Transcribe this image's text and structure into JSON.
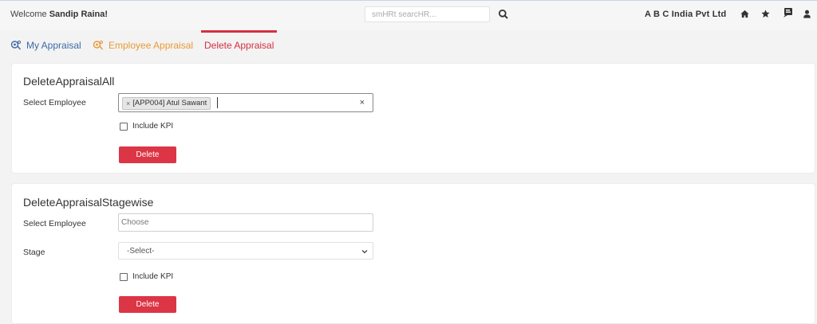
{
  "header": {
    "welcome_prefix": "Welcome",
    "user_name": "Sandip Raina!",
    "search_placeholder": "smHRt searcHR...",
    "company": "A B C India Pvt Ltd",
    "icons": [
      "search-icon",
      "home-icon",
      "star-icon",
      "notification-icon",
      "user-icon"
    ]
  },
  "tabs": [
    {
      "label": "My Appraisal",
      "icon": "appraisal-icon",
      "color": "#3d6aa8"
    },
    {
      "label": "Employee Appraisal",
      "icon": "appraisal-icon",
      "color": "#e89a34"
    },
    {
      "label": "Delete Appraisal",
      "active": true,
      "color": "#d43040"
    }
  ],
  "delete_all": {
    "title": "DeleteAppraisalAll",
    "employee_label": "Select Employee",
    "selected_employee": "[APP004] Atul Sawant",
    "chip_remove": "×",
    "clear": "×",
    "include_kpi": "Include KPI",
    "button": "Delete"
  },
  "delete_stagewise": {
    "title": "DeleteAppraisalStagewise",
    "employee_label": "Select Employee",
    "employee_placeholder": "Choose",
    "stage_label": "Stage",
    "stage_value": "-Select-",
    "include_kpi": "Include KPI",
    "button": "Delete"
  },
  "colors": {
    "accent_red": "#dc3545",
    "tab_blue": "#3d6aa8",
    "tab_orange": "#e89a34"
  }
}
